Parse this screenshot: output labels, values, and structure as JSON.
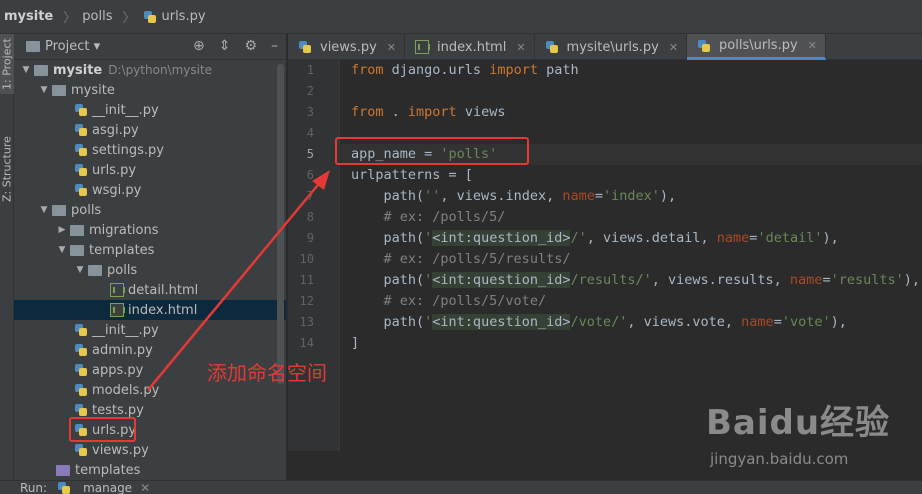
{
  "breadcrumb": {
    "items": [
      "mysite",
      "polls",
      "urls.py"
    ]
  },
  "toolstrip": {
    "project_tab": "1: Project",
    "structure_tab": "Z: Structure"
  },
  "project_panel": {
    "title": "Project ▾"
  },
  "tree": [
    {
      "label": "mysite",
      "path": "D:\\python\\mysite"
    },
    {
      "label": "mysite"
    },
    {
      "label": "__init__.py"
    },
    {
      "label": "asgi.py"
    },
    {
      "label": "settings.py"
    },
    {
      "label": "urls.py"
    },
    {
      "label": "wsgi.py"
    },
    {
      "label": "polls"
    },
    {
      "label": "migrations"
    },
    {
      "label": "templates"
    },
    {
      "label": "polls"
    },
    {
      "label": "detail.html"
    },
    {
      "label": "index.html"
    },
    {
      "label": "__init__.py"
    },
    {
      "label": "admin.py"
    },
    {
      "label": "apps.py"
    },
    {
      "label": "models.py"
    },
    {
      "label": "tests.py"
    },
    {
      "label": "urls.py"
    },
    {
      "label": "views.py"
    },
    {
      "label": "templates"
    }
  ],
  "tabs": [
    {
      "label": "views.py",
      "icon": "python-file-icon"
    },
    {
      "label": "index.html",
      "icon": "html-file-icon"
    },
    {
      "label": "mysite\\urls.py",
      "icon": "python-file-icon"
    },
    {
      "label": "polls\\urls.py",
      "icon": "python-file-icon",
      "active": true
    }
  ],
  "editor": {
    "line_numbers": [
      "1",
      "2",
      "3",
      "4",
      "5",
      "6",
      "7",
      "8",
      "9",
      "10",
      "11",
      "12",
      "13",
      "14"
    ],
    "current_line": "5"
  },
  "annotation": {
    "text": "添加命名空间"
  },
  "watermark": {
    "brand": "Baidu经验",
    "url": "jingyan.baidu.com"
  },
  "bottom": {
    "run_label": "Run:",
    "run_target": "manage"
  }
}
